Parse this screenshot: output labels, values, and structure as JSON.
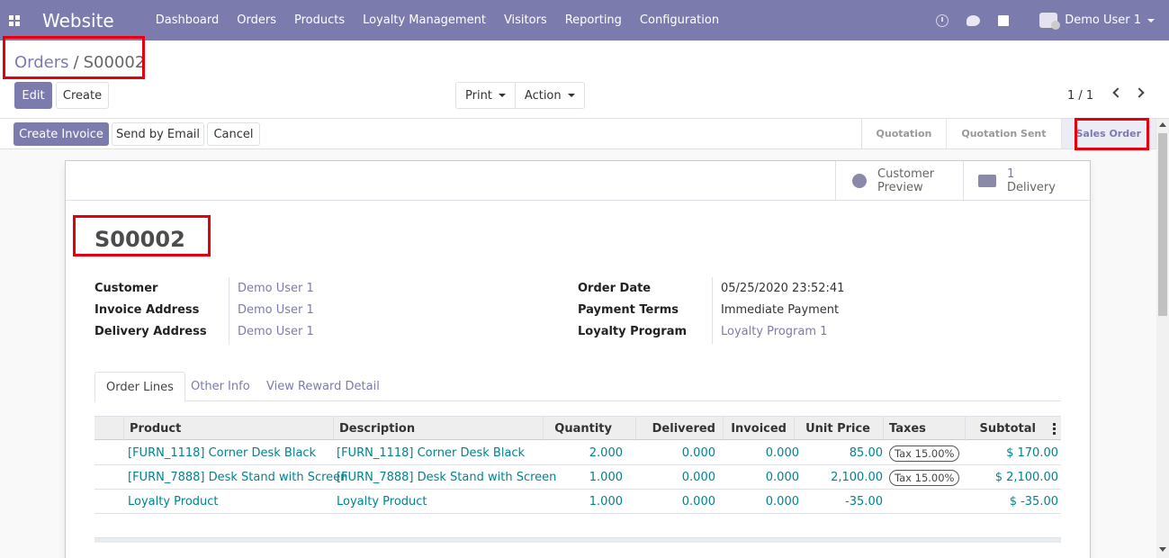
{
  "navbar": {
    "brand": "Website",
    "menu": [
      "Dashboard",
      "Orders",
      "Products",
      "Loyalty Management",
      "Visitors",
      "Reporting",
      "Configuration"
    ],
    "user": "Demo User 1"
  },
  "breadcrumb": {
    "parent": "Orders",
    "separator": "/",
    "current": "S00002"
  },
  "toolbar": {
    "edit": "Edit",
    "create": "Create",
    "print": "Print",
    "action": "Action",
    "pager": "1 / 1"
  },
  "statusbar": {
    "create_invoice": "Create Invoice",
    "send_email": "Send by Email",
    "cancel": "Cancel",
    "stages": [
      "Quotation",
      "Quotation Sent",
      "Sales Order"
    ],
    "active_stage": "Sales Order"
  },
  "smart_buttons": {
    "preview_line1": "Customer",
    "preview_line2": "Preview",
    "delivery_count": "1",
    "delivery_label": "Delivery"
  },
  "order": {
    "name": "S00002",
    "customer_label": "Customer",
    "customer": "Demo User 1",
    "invoice_address_label": "Invoice Address",
    "invoice_address": "Demo User 1",
    "delivery_address_label": "Delivery Address",
    "delivery_address": "Demo User 1",
    "order_date_label": "Order Date",
    "order_date": "05/25/2020 23:52:41",
    "payment_terms_label": "Payment Terms",
    "payment_terms": "Immediate Payment",
    "loyalty_program_label": "Loyalty Program",
    "loyalty_program": "Loyalty Program 1"
  },
  "tabs": [
    "Order Lines",
    "Other Info",
    "View Reward Detail"
  ],
  "table": {
    "headers": [
      "Product",
      "Description",
      "Quantity",
      "Delivered",
      "Invoiced",
      "Unit Price",
      "Taxes",
      "Subtotal"
    ],
    "rows": [
      {
        "product": "[FURN_1118] Corner Desk Black",
        "description": "[FURN_1118] Corner Desk Black",
        "quantity": "2.000",
        "delivered": "0.000",
        "invoiced": "0.000",
        "unit_price": "85.00",
        "taxes": "Tax 15.00%",
        "subtotal": "$ 170.00"
      },
      {
        "product": "[FURN_7888] Desk Stand with Screen",
        "description": "[FURN_7888] Desk Stand with Screen",
        "quantity": "1.000",
        "delivered": "0.000",
        "invoiced": "0.000",
        "unit_price": "2,100.00",
        "taxes": "Tax 15.00%",
        "subtotal": "$ 2,100.00"
      },
      {
        "product": "Loyalty Product",
        "description": "Loyalty Product",
        "quantity": "1.000",
        "delivered": "0.000",
        "invoiced": "0.000",
        "unit_price": "-35.00",
        "taxes": "",
        "subtotal": "$ -35.00"
      }
    ]
  },
  "colors": {
    "brand": "#7c7bad",
    "link": "#00838f",
    "highlight": "#e4000f"
  }
}
